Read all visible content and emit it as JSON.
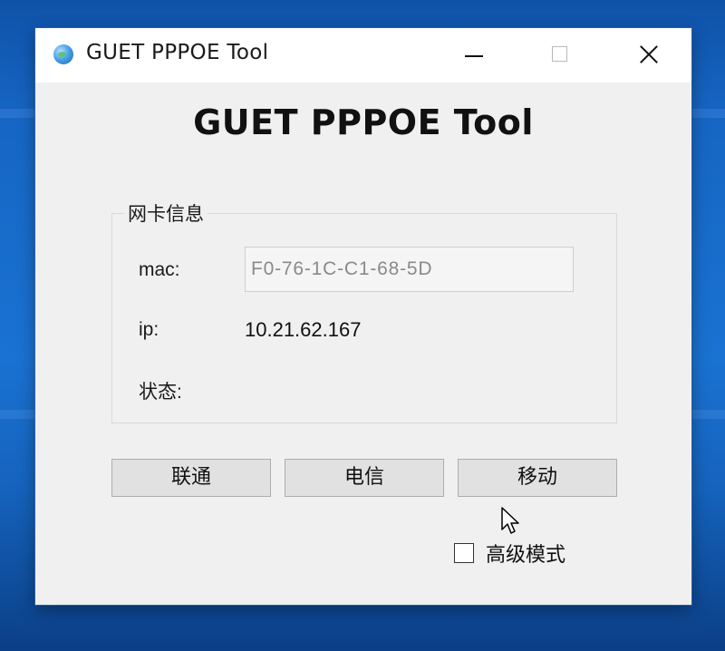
{
  "window": {
    "title": "GUET PPPOE Tool",
    "controls": {
      "minimize": "minimize-icon",
      "maximize": "maximize-icon",
      "close": "close-icon"
    }
  },
  "main": {
    "heading": "GUET PPPOE Tool"
  },
  "nic_info": {
    "legend": "网卡信息",
    "mac_label": "mac:",
    "mac_value": "F0-76-1C-C1-68-5D",
    "ip_label": "ip:",
    "ip_value": "10.21.62.167",
    "status_label": "状态:"
  },
  "buttons": {
    "unicom": "联通",
    "telecom": "电信",
    "mobile": "移动"
  },
  "advanced_mode": {
    "label": "高级模式",
    "checked": false
  },
  "colors": {
    "desktop": "#1a72d2",
    "window_bg": "#f0f0f0",
    "button_bg": "#e1e1e1"
  }
}
